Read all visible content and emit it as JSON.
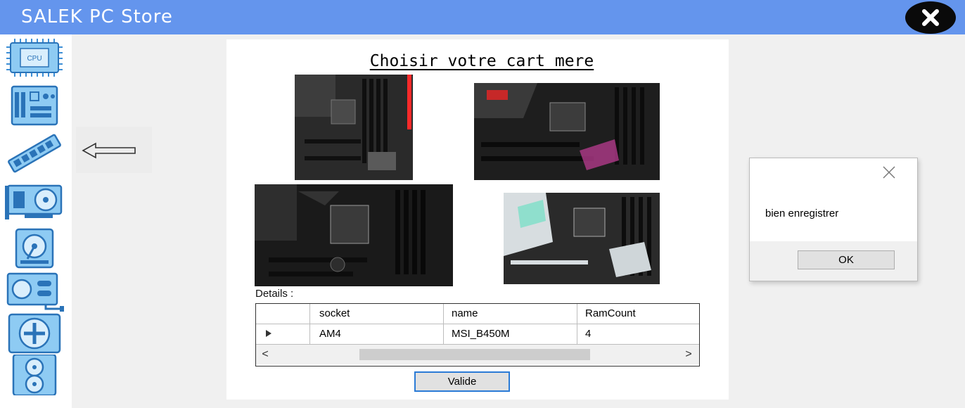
{
  "window": {
    "title": "SALEK PC Store",
    "close_icon": "close-icon"
  },
  "sidebar": {
    "accent": "#3d8fd6",
    "items": [
      {
        "id": "cpu",
        "icon": "cpu-icon",
        "label": "CPU"
      },
      {
        "id": "motherboard",
        "icon": "motherboard-icon"
      },
      {
        "id": "ram",
        "icon": "ram-icon"
      },
      {
        "id": "gpu",
        "icon": "graphics-card-icon"
      },
      {
        "id": "hdd",
        "icon": "hard-drive-icon"
      },
      {
        "id": "psu",
        "icon": "power-supply-icon"
      },
      {
        "id": "cooler",
        "icon": "cooler-icon"
      },
      {
        "id": "case",
        "icon": "case-fan-icon"
      }
    ]
  },
  "back_arrow": {
    "icon": "left-arrow-icon"
  },
  "main": {
    "title": "Choisir votre cart mere ",
    "boards": [
      "motherboard-1",
      "motherboard-2",
      "motherboard-3",
      "motherboard-4"
    ],
    "details_label": "Details :",
    "grid": {
      "columns": [
        "socket",
        "name",
        "RamCount"
      ],
      "rows": [
        {
          "socket": "AM4",
          "name": "MSI_B450M",
          "ram_count": "4"
        }
      ],
      "row_indicator_icon": "row-selector-icon",
      "scroll_left": "<",
      "scroll_right": ">"
    },
    "valide_button": "Valide"
  },
  "dialog": {
    "message": "bien enregistrer",
    "ok": "OK"
  },
  "colors": {
    "titlebar": "#6495ed",
    "button_focus": "#2b7bd6"
  }
}
